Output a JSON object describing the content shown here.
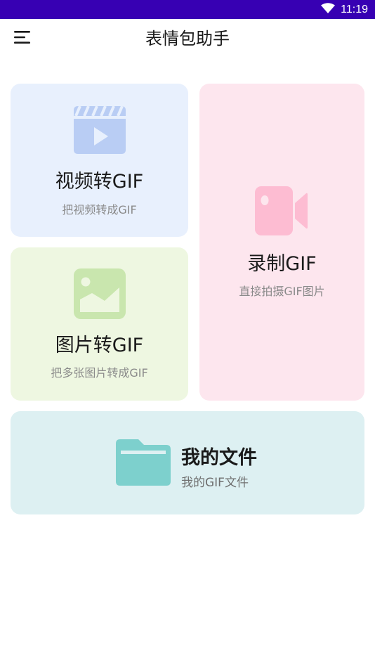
{
  "status_bar": {
    "time": "11:19",
    "icons": [
      "wifi-icon"
    ]
  },
  "app_bar": {
    "title": "表情包助手",
    "menu_icon": "menu-icon"
  },
  "cards": {
    "video_to_gif": {
      "title": "视频转GIF",
      "subtitle": "把视频转成GIF",
      "icon": "video-clapper-icon",
      "color": "#e8f0fd",
      "icon_color": "#b9cdf4"
    },
    "image_to_gif": {
      "title": "图片转GIF",
      "subtitle": "把多张图片转成GIF",
      "icon": "image-icon",
      "color": "#eef7e1",
      "icon_color": "#c9e6ae"
    },
    "record_gif": {
      "title": "录制GIF",
      "subtitle": "直接拍摄GIF图片",
      "icon": "video-camera-icon",
      "color": "#fde6ee",
      "icon_color": "#fdbcd2"
    },
    "my_files": {
      "title": "我的文件",
      "subtitle": "我的GIF文件",
      "icon": "folder-icon",
      "color": "#ddf0f2",
      "icon_color": "#7dd0cd"
    }
  }
}
